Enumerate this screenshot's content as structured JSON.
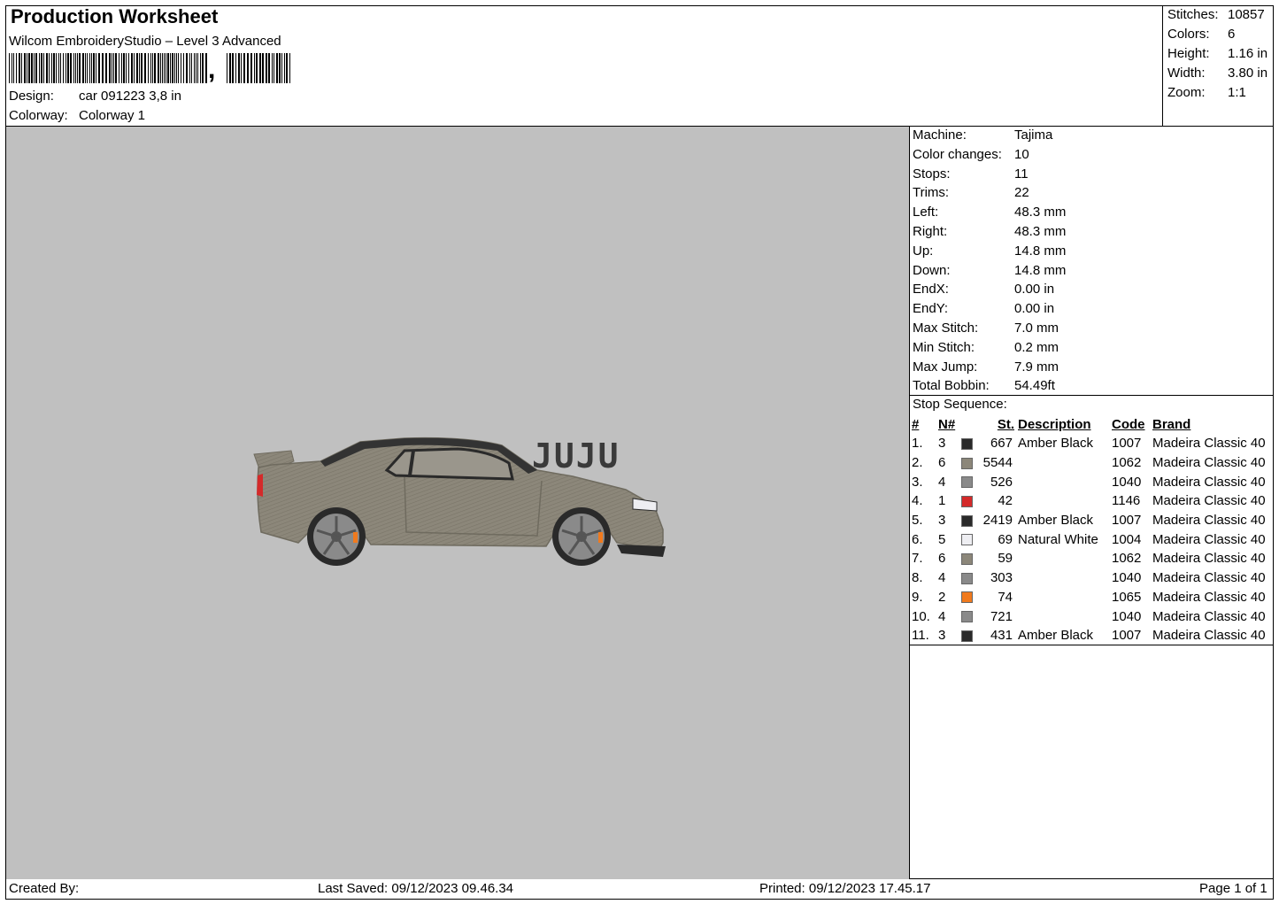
{
  "header": {
    "title": "Production Worksheet",
    "software": "Wilcom EmbroideryStudio – Level 3 Advanced",
    "barcode_mark": ",",
    "design_label": "Design:",
    "design_value": "car 091223 3,8 in",
    "colorway_label": "Colorway:",
    "colorway_value": "Colorway 1"
  },
  "summary": [
    {
      "label": "Stitches:",
      "value": "10857"
    },
    {
      "label": "Colors:",
      "value": "6"
    },
    {
      "label": "Height:",
      "value": "1.16 in"
    },
    {
      "label": "Width:",
      "value": "3.80 in"
    },
    {
      "label": "Zoom:",
      "value": "1:1"
    }
  ],
  "machine_info": [
    {
      "label": "Machine:",
      "value": "Tajima"
    },
    {
      "label": "Color changes:",
      "value": "10"
    },
    {
      "label": "Stops:",
      "value": "11"
    },
    {
      "label": "Trims:",
      "value": "22"
    },
    {
      "label": "Left:",
      "value": "48.3 mm"
    },
    {
      "label": "Right:",
      "value": "48.3 mm"
    },
    {
      "label": "Up:",
      "value": "14.8 mm"
    },
    {
      "label": "Down:",
      "value": "14.8 mm"
    },
    {
      "label": "EndX:",
      "value": "0.00 in"
    },
    {
      "label": "EndY:",
      "value": "0.00 in"
    },
    {
      "label": "Max Stitch:",
      "value": "7.0 mm"
    },
    {
      "label": "Min Stitch:",
      "value": "0.2 mm"
    },
    {
      "label": "Max Jump:",
      "value": "7.9 mm"
    },
    {
      "label": "Total Bobbin:",
      "value": "54.49ft"
    }
  ],
  "stop_sequence": {
    "title": "Stop Sequence:",
    "columns": [
      "#",
      "N#",
      "St.",
      "Description",
      "Code",
      "Brand"
    ],
    "rows": [
      {
        "n": "1.",
        "needle": "3",
        "color": "#2a2a2a",
        "st": "667",
        "desc": "Amber Black",
        "code": "1007",
        "brand": "Madeira Classic 40"
      },
      {
        "n": "2.",
        "needle": "6",
        "color": "#8c877a",
        "st": "5544",
        "desc": "",
        "code": "1062",
        "brand": "Madeira Classic 40"
      },
      {
        "n": "3.",
        "needle": "4",
        "color": "#8a8a8a",
        "st": "526",
        "desc": "",
        "code": "1040",
        "brand": "Madeira Classic 40"
      },
      {
        "n": "4.",
        "needle": "1",
        "color": "#d42a2a",
        "st": "42",
        "desc": "",
        "code": "1146",
        "brand": "Madeira Classic 40"
      },
      {
        "n": "5.",
        "needle": "3",
        "color": "#2a2a2a",
        "st": "2419",
        "desc": "Amber Black",
        "code": "1007",
        "brand": "Madeira Classic 40"
      },
      {
        "n": "6.",
        "needle": "5",
        "color": "#eeeef2",
        "st": "69",
        "desc": "Natural White",
        "code": "1004",
        "brand": "Madeira Classic 40"
      },
      {
        "n": "7.",
        "needle": "6",
        "color": "#8c877a",
        "st": "59",
        "desc": "",
        "code": "1062",
        "brand": "Madeira Classic 40"
      },
      {
        "n": "8.",
        "needle": "4",
        "color": "#8a8a8a",
        "st": "303",
        "desc": "",
        "code": "1040",
        "brand": "Madeira Classic 40"
      },
      {
        "n": "9.",
        "needle": "2",
        "color": "#f07a1e",
        "st": "74",
        "desc": "",
        "code": "1065",
        "brand": "Madeira Classic 40"
      },
      {
        "n": "10.",
        "needle": "4",
        "color": "#8a8a8a",
        "st": "721",
        "desc": "",
        "code": "1040",
        "brand": "Madeira Classic 40"
      },
      {
        "n": "11.",
        "needle": "3",
        "color": "#2a2a2a",
        "st": "431",
        "desc": "Amber Black",
        "code": "1007",
        "brand": "Madeira Classic 40"
      }
    ]
  },
  "design": {
    "text": "JUJU",
    "body_color": "#8c877a",
    "text_color": "#3a3a3a"
  },
  "footer": {
    "created_by": "Created By:",
    "last_saved": "Last Saved: 09/12/2023 09.46.34",
    "printed": "Printed: 09/12/2023 17.45.17",
    "page": "Page 1 of 1"
  }
}
